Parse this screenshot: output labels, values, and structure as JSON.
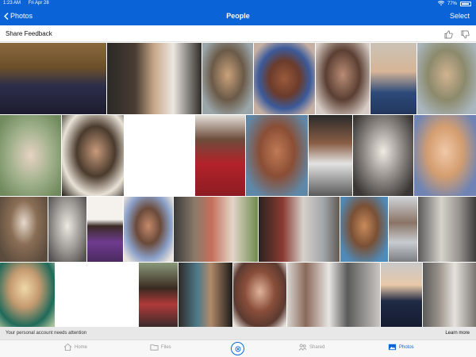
{
  "status_bar": {
    "time": "1:23 AM",
    "date": "Fri Apr 28",
    "battery": "77%"
  },
  "nav": {
    "back_label": "Photos",
    "title": "People",
    "select_label": "Select"
  },
  "feedback": {
    "label": "Share Feedback",
    "thumbs_up_icon": "thumbs-up-icon",
    "thumbs_down_icon": "thumbs-down-icon"
  },
  "banner": {
    "message": "Your personal account needs attention",
    "link": "Learn more"
  },
  "tabs": [
    {
      "label": "Home",
      "icon": "home-icon"
    },
    {
      "label": "Files",
      "icon": "folder-icon"
    },
    {
      "label": "Shared",
      "icon": "people-icon"
    },
    {
      "label": "Photos",
      "icon": "photos-icon"
    }
  ],
  "colors": {
    "brand": "#0a64d8",
    "banner_bg": "#e8e8e8"
  }
}
